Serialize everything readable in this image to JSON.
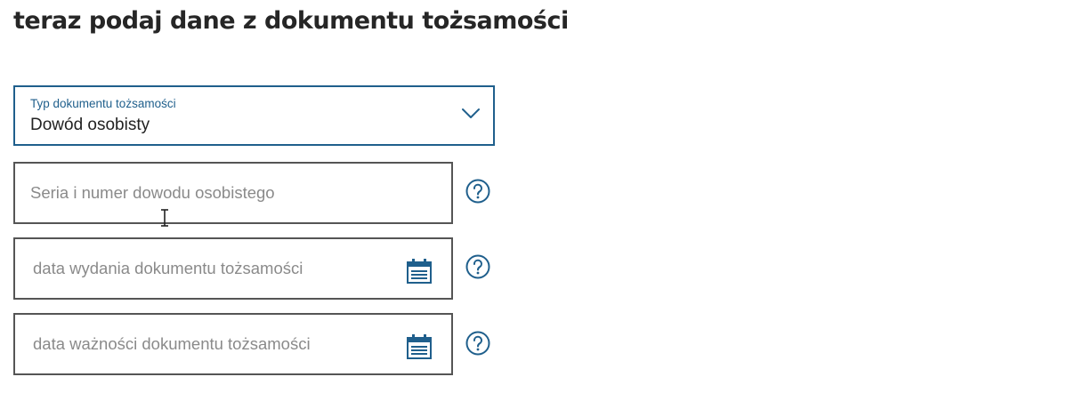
{
  "page": {
    "title": "teraz podaj dane z dokumentu tożsamości"
  },
  "document_type": {
    "label": "Typ dokumentu tożsamości",
    "value": "Dowód osobisty"
  },
  "fields": {
    "id_number": {
      "placeholder": "Seria i numer dowodu osobistego",
      "value": ""
    },
    "issue_date": {
      "placeholder": "data wydania dokumentu tożsamości",
      "value": ""
    },
    "expiry_date": {
      "placeholder": "data ważności dokumentu tożsamości",
      "value": ""
    }
  },
  "icons": {
    "chevron": "chevron-down-icon",
    "calendar": "calendar-icon",
    "help": "help-circle-icon",
    "cursor": "text-cursor-icon"
  },
  "colors": {
    "accent": "#1f5f8c",
    "field_border": "#555555",
    "placeholder": "#8a8a8a",
    "title": "#262626"
  }
}
